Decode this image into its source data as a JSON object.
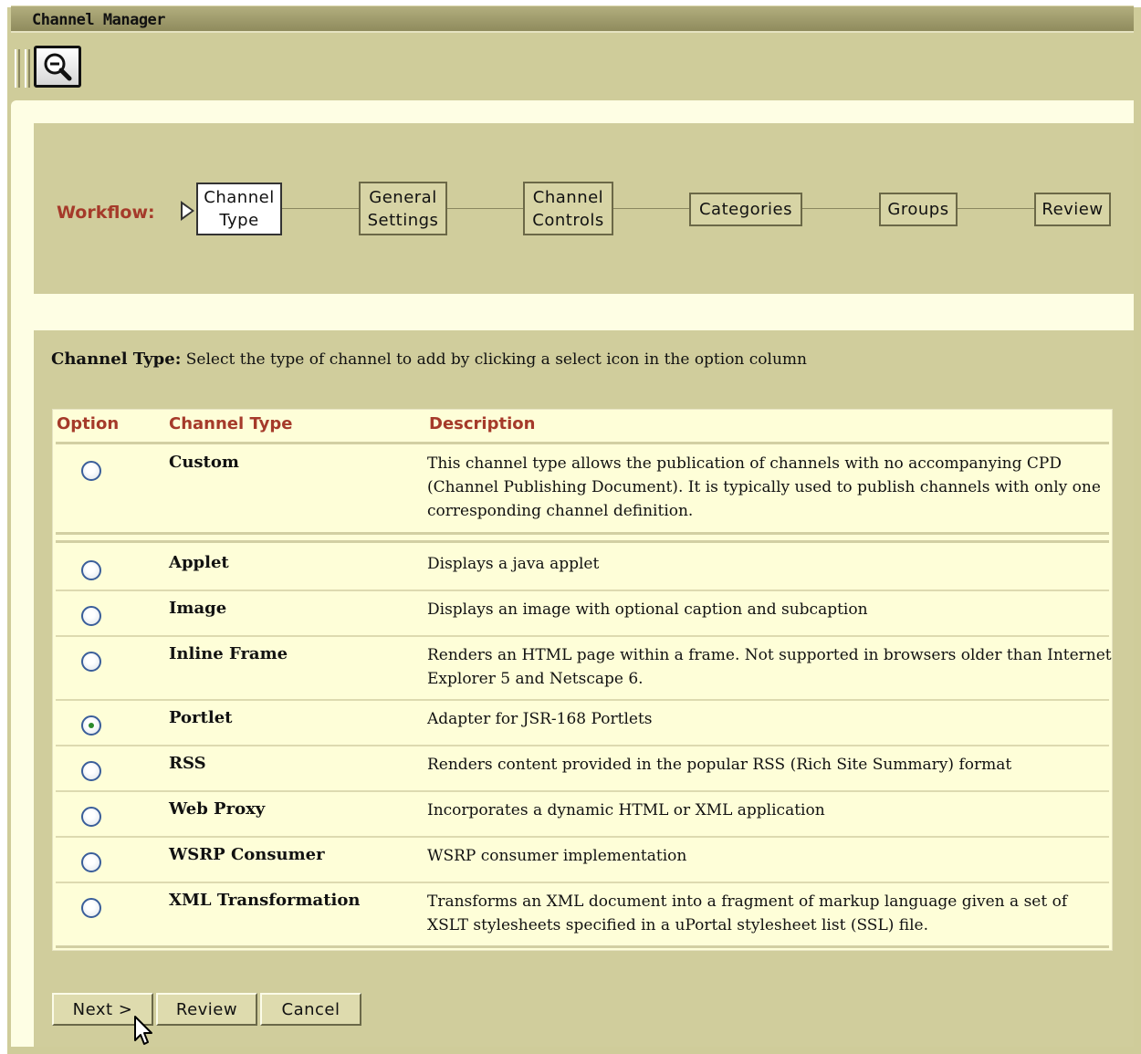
{
  "window": {
    "title": "Channel Manager"
  },
  "toolbar": {
    "zoom_icon": "zoom-out-icon"
  },
  "workflow": {
    "label": "Workflow:",
    "steps": [
      {
        "label": "Channel\nType",
        "active": true
      },
      {
        "label": "General\nSettings",
        "active": false
      },
      {
        "label": "Channel\nControls",
        "active": false
      },
      {
        "label": "Categories",
        "active": false
      },
      {
        "label": "Groups",
        "active": false
      },
      {
        "label": "Review",
        "active": false
      }
    ]
  },
  "instruction": {
    "heading": "Channel Type:",
    "text": "Select the type of channel to add by clicking a select icon in the option column"
  },
  "table": {
    "columns": [
      "Option",
      "Channel Type",
      "Description"
    ],
    "rows": [
      {
        "type": "Custom",
        "description": "This channel type allows the publication of channels with no accompanying CPD (Channel Publishing Document). It is typically used to publish channels with only one corresponding channel definition.",
        "selected": false
      },
      {
        "type": "Applet",
        "description": "Displays a java applet",
        "selected": false
      },
      {
        "type": "Image",
        "description": "Displays an image with optional caption and subcaption",
        "selected": false
      },
      {
        "type": "Inline Frame",
        "description": "Renders an HTML page within a frame. Not supported in browsers older than Internet Explorer 5 and Netscape 6.",
        "selected": false
      },
      {
        "type": "Portlet",
        "description": "Adapter for JSR-168 Portlets",
        "selected": true
      },
      {
        "type": "RSS",
        "description": "Renders content provided in the popular RSS (Rich Site Summary) format",
        "selected": false
      },
      {
        "type": "Web Proxy",
        "description": "Incorporates a dynamic HTML or XML application",
        "selected": false
      },
      {
        "type": "WSRP Consumer",
        "description": "WSRP consumer implementation",
        "selected": false
      },
      {
        "type": "XML Transformation",
        "description": "Transforms an XML document into a fragment of markup language given a set of XSLT stylesheets specified in a uPortal stylesheet list (SSL) file.",
        "selected": false
      }
    ]
  },
  "buttons": {
    "next": "Next >",
    "review": "Review",
    "cancel": "Cancel"
  },
  "colors": {
    "accent_red": "#a53a2a",
    "panel": "#d0cd9c",
    "content_bg": "#fefee4"
  }
}
